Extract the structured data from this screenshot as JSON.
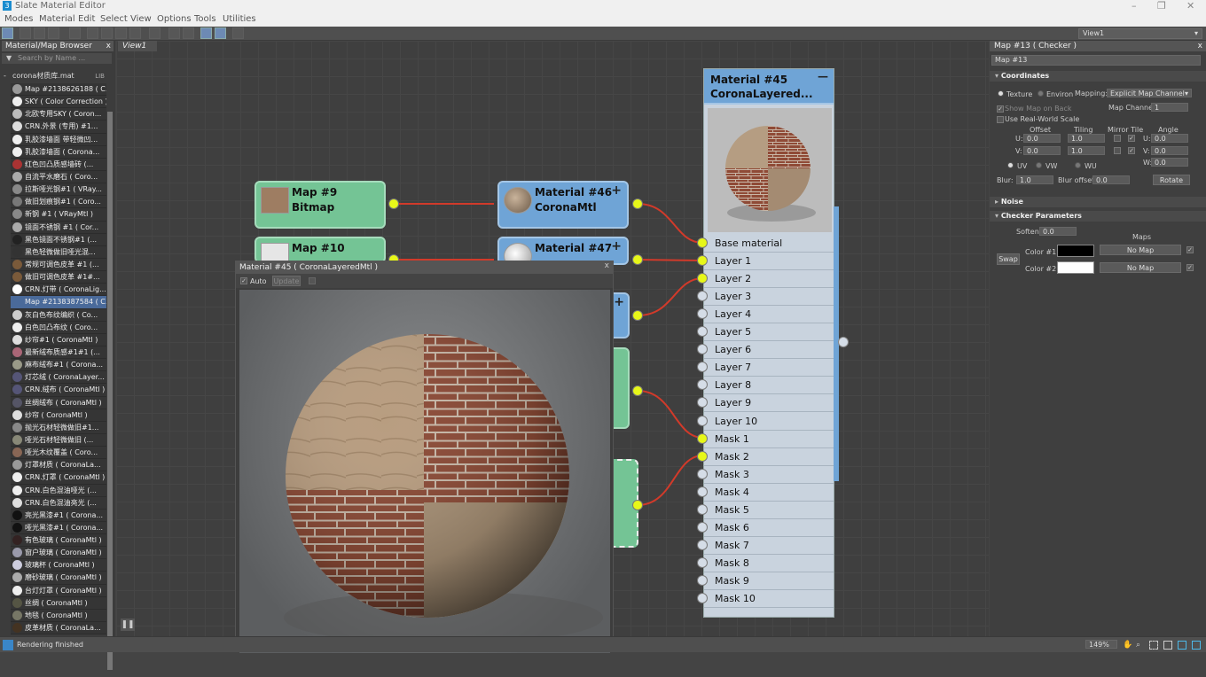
{
  "titlebar": {
    "app_icon": "3",
    "title": "Slate Material Editor",
    "minimize": "–",
    "maximize": "❐",
    "close": "✕"
  },
  "menu": [
    "Modes",
    "Material",
    "Edit",
    "Select",
    "View",
    "Options",
    "Tools",
    "Utilities"
  ],
  "view_selector": "View1",
  "browser": {
    "title": "Material/Map Browser",
    "search_placeholder": "Search by Name ...",
    "library": "corona材质库.mat",
    "library_tag": "LIB",
    "items": [
      "Map #2138626188 ( C...",
      "SKY ( Color Correction )",
      "北欧专用SKY ( Coron...",
      "CRN.外景 (专用) #1...",
      "乳胶漆墙面 带轻微凹...",
      "乳胶漆墙面 ( Corona...",
      "红色凹凸质感墙砖 (...",
      "自流平水磨石 ( Coro...",
      "拉斯哑光钢#1 ( VRay...",
      "做旧划痕钢#1 ( Coro...",
      "新钢 #1 ( VRayMtl )",
      "镜面不锈钢 #1 ( Cor...",
      "黑色镜面不锈钢#1 (...",
      "黑色轻微做旧哑光混...",
      "常规可调色皮革 #1 (...",
      "做旧可调色皮革 #1#...",
      "CRN.灯带 ( CoronaLig...",
      "Map #2138387584 ( C...",
      "灰白色布纹编织 ( Co...",
      "白色凹凸布纹 ( Coro...",
      "纱帘#1 ( CoronaMtl )",
      "最新绒布质感#1#1 (...",
      "麻布绒布#1 ( Corona...",
      "灯芯绒 ( CoronaLayer...",
      "CRN.绒布 ( CoronaMtl )",
      "丝绸绒布 ( CoronaMtl )",
      "纱帘 ( CoronaMtl )",
      "抛光石材轻微做旧#1...",
      "哑光石材轻微做旧 (...",
      "哑光木纹覆盖 ( Coro...",
      "灯罩材质 ( CoronaLa...",
      "CRN.灯罩 ( CoronaMtl )",
      "CRN.白色混油哑光 (...",
      "CRN.白色混油亮光 (...",
      "亮光黑漆#1 ( Corona...",
      "哑光黑漆#1 ( Corona...",
      "有色玻璃 ( CoronaMtl )",
      "窗户玻璃 ( CoronaMtl )",
      "玻璃杯 ( CoronaMtl )",
      "磨砂玻璃 ( CoronaMtl )",
      "台灯灯罩 ( CoronaMtl )",
      "丝绸 ( CoronaMtl )",
      "地毯 ( CoronaMtl )",
      "皮革材质 ( CoronaLa..."
    ]
  },
  "view_tab": "View1",
  "nodes": {
    "map9": {
      "l1": "Map #9",
      "l2": "Bitmap"
    },
    "map10": {
      "l1": "Map #10",
      "l2": "Bi..."
    },
    "mat46": {
      "l1": "Material #46",
      "l2": "CoronaMtl"
    },
    "mat47": {
      "l1": "Material #47",
      "l2": "C..."
    },
    "mat45": {
      "l1": "Material #45",
      "l2": "CoronaLayered..."
    }
  },
  "slots": [
    "Base material",
    "Layer 1",
    "Layer 2",
    "Layer 3",
    "Layer 4",
    "Layer 5",
    "Layer 6",
    "Layer 7",
    "Layer 8",
    "Layer 9",
    "Layer 10",
    "Mask 1",
    "Mask 2",
    "Mask 3",
    "Mask 4",
    "Mask 5",
    "Mask 6",
    "Mask 7",
    "Mask 8",
    "Mask 9",
    "Mask 10"
  ],
  "preview": {
    "title": "Material #45 ( CoronaLayeredMtl )",
    "auto": "Auto",
    "update": "Update",
    "close": "x"
  },
  "props": {
    "title": "Map #13 ( Checker )",
    "name": "Map #13",
    "coordinates": "Coordinates",
    "texture": "Texture",
    "environ": "Environ",
    "mapping_label": "Mapping:",
    "mapping": "Explicit Map Channel",
    "show_map_on_back": "Show Map on Back",
    "map_channel_label": "Map Channel:",
    "map_channel": "1",
    "real_world": "Use Real-World Scale",
    "offset": "Offset",
    "tiling": "Tiling",
    "mirror_tile": "Mirror Tile",
    "angle": "Angle",
    "u": "U:",
    "v": "V:",
    "w": "W:",
    "u_offset": "0.0",
    "v_offset": "0.0",
    "u_tiling": "1.0",
    "v_tiling": "1.0",
    "u_angle": "0.0",
    "v_angle": "0.0",
    "w_angle": "0.0",
    "uv": "UV",
    "vw": "VW",
    "wu": "WU",
    "blur_label": "Blur:",
    "blur": "1.0",
    "blur_offset_label": "Blur offset:",
    "blur_offset": "0.0",
    "rotate": "Rotate",
    "noise": "Noise",
    "checker": "Checker Parameters",
    "soften_label": "Soften:",
    "soften": "0.0",
    "maps": "Maps",
    "swap": "Swap",
    "color1_label": "Color #1:",
    "color2_label": "Color #2:",
    "no_map": "No Map",
    "color1": "#000000",
    "color2": "#ffffff"
  },
  "status": {
    "text": "Rendering finished",
    "zoom": "149%"
  }
}
